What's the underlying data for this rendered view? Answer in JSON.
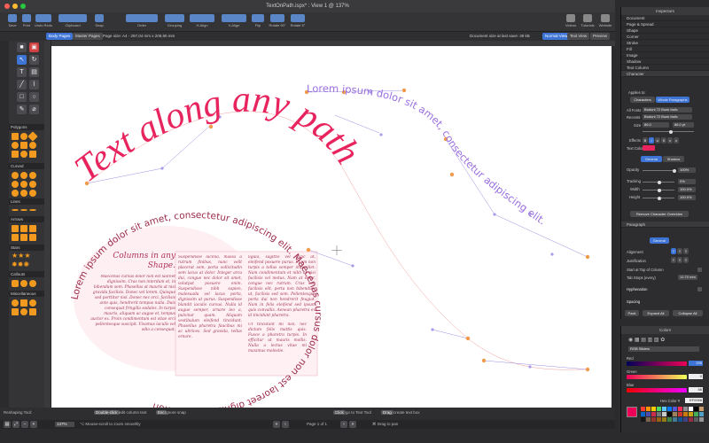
{
  "window": {
    "title": "TextOnPath.ispx* : View 1 @ 137%"
  },
  "toolbar": {
    "items": [
      {
        "label": "Save"
      },
      {
        "label": "Print"
      },
      {
        "label": "Undo Redo"
      },
      {
        "label": "Clipboard"
      },
      {
        "label": "Snap"
      },
      {
        "label": "Order"
      },
      {
        "label": "Grouping"
      },
      {
        "label": "H-Align"
      },
      {
        "label": "V-Align"
      },
      {
        "label": "Flip"
      },
      {
        "label": "Rotate 90°"
      },
      {
        "label": "Rotate 5°"
      },
      {
        "label": "Videos"
      },
      {
        "label": "Tutorials"
      },
      {
        "label": "Website"
      }
    ]
  },
  "subbar": {
    "tab_body": "Body Pages",
    "tab_master": "Master Pages",
    "page_size": "Page size:  A4 - 297,04 mm x 209,90 mm",
    "doc_size": "Document size at last save:  39 kB",
    "view_normal": "Normal View",
    "view_text": "Text View",
    "view_preview": "Preview"
  },
  "tools": {
    "sections": [
      "Polygons",
      "Curved",
      "Lines",
      "Arrows",
      "Stars",
      "Callouts",
      "Miscellaneous"
    ]
  },
  "canvas": {
    "big_path_text": "Text along any path",
    "top_path_text": "Lorem ipsum dolor sit amet, consectetur adipiscing elit.",
    "circle_text": "Lorem ipsum dolor sit amet, consectetur adipiscing elit. Maecenas cursus dolor non est laoreet dignissim. Cras non",
    "columns_heading": "Columns in any Shape.",
    "col1": "Maecenas cursus dolor non est laoreet dignissim. Cras non interdum et, in bibendum sem. Phasellus at mauris at nisi gravida facilisis. Donec vel lorem. Quisque sed porttitor nisl. Donec nec orci, facilisis ante quis, hendrerit tempus nulla. Duis consequat fringilla sodales. In turpis mauris, aliquam ac augue et, tempus auctor ex. Proin condimentum est vitae orci pellentesque suscipit. Vivamus iaculis vel odio a consequat.",
    "col2": "Suspendisse lacinia, massa a rutrum finibus, nunc velit placerat sem, porta sollicitudin sem lacus at dolor. Integer arcu dui, congue nec dolor sit amet, volutpat posuere enim. Suspendisse nibh sapien, malesuada vel lacus porta, dignissim ut purus. Suspendisse blandit iaculis cursus. Nulla id augue semper, ornare leo a, pulvinar quam. Aliquam vestibulum eleifend tincidunt. Phasellus pharetra faucibus mi ac ultrices. Sed gravida, tellus ornare.",
    "col3": "ligula, sagittis vel nunc at, eleifend posuere purus. Etiam non turpis a tellus semper imperdiet. Nam condimentum et nibh at nisi facilisis vel metus. Nam at dolor, congue nec rutrum. Cras non facilisis elit, porta non bibendum ut, facilisis sed sem. Pellentesque porta dui non hendrerit feugiat. Nam in felis eleifend sed ipsum quis convallis. Aenean pharetra ex id tincidunt pharetra.",
    "col4": "Ut tincidunt mi nisl, nec dictum felis mattis quis. Fusce a pharetra turpis. In efficitur ut mauris mollis. Nulla a lectus vitae mi maximus molestie."
  },
  "bottom": {
    "hint_label": "Reshaping Tool:",
    "tip1": "Double-click",
    "tip1_text": "edit column text",
    "tip2": "Esc",
    "tip2_text": "Ignore snap",
    "tip3": "Click",
    "tip3_text": "go to Text Tool",
    "tip4": "Drag",
    "tip4_text": "create text box",
    "zoom": "137%",
    "zoom_hint": "⌥ Mouse-scroll to zoom smoothly",
    "page": "Page 1 of 1",
    "pan_hint": "⌘ Drag to pan"
  },
  "inspectors": {
    "title": "Inspectors",
    "sections": [
      "Document",
      "Page & Spread",
      "Shape",
      "Corner",
      "Stroke",
      "Fill",
      "Image",
      "Shadow",
      "Text Column",
      "Character"
    ],
    "applies_to": "Applies to:",
    "applies_characters": "Characters",
    "applies_whole": "Whole Paragraphs",
    "all_fonts_label": "All Fonts",
    "all_fonts_value": "Bodoni 72 Book Italic",
    "recents_label": "Recents",
    "recents_value": "Bodoni 72 Book Italic",
    "size_label": "Size",
    "size_value": "86.0",
    "size_value2": "86.0 pt",
    "effects_label": "Effects",
    "effects_buttons": [
      "B",
      "I",
      "U",
      "S",
      "x",
      "x"
    ],
    "text_color_label": "Text Color",
    "tab_general": "General",
    "tab_shadow": "Shadow",
    "opacity_label": "Opacity",
    "opacity_value": "100%",
    "tracking_label": "Tracking",
    "tracking_value": "0%",
    "width_label": "Width",
    "width_value": "100.0%",
    "height_label": "Height",
    "height_value": "100.0%",
    "remove_overrides": "Remove Character Overrides",
    "paragraph_title": "Paragraph",
    "para_tab_general": "General",
    "alignment_label": "Alignment",
    "justification_label": "Justification",
    "start_top_label": "Start at Top of Column",
    "tab_stops_label": "Tab Stops (every)",
    "tab_stops_value": "12.70 mm",
    "hyphenation_label": "Hyphenation",
    "spacing_label": "Spacing",
    "btn_pack": "Pack",
    "btn_expand": "Expand All",
    "btn_collapse": "Collapse All"
  },
  "colors_panel": {
    "title": "Colors",
    "mode": "RGB Sliders",
    "red_label": "Red",
    "red_value": "239",
    "green_label": "Green",
    "green_value": "0",
    "blue_label": "Blue",
    "blue_value": "88",
    "hex_label": "Hex Color #",
    "hex_value": "EF0058",
    "swatch_color": "#ef0058"
  },
  "colors": {
    "accent": "#3d74d6",
    "path_text_pink": "#e8245e",
    "path_text_purple": "#9b6fe0",
    "circle_text": "#9c2a4a"
  }
}
